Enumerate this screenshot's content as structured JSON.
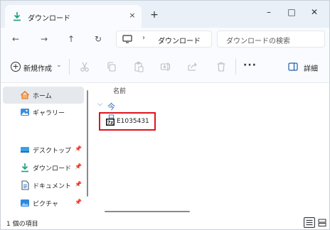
{
  "tab": {
    "title": "ダウンロード",
    "close_glyph": "×"
  },
  "titlebar": {
    "new_tab_glyph": "+",
    "minimize_glyph": "–",
    "maximize_glyph": "□",
    "close_glyph": "✕"
  },
  "nav": {
    "back_glyph": "←",
    "forward_glyph": "→",
    "up_glyph": "↑",
    "refresh_glyph": "↻"
  },
  "address": {
    "separator": "›",
    "location": "ダウンロード"
  },
  "search": {
    "placeholder": "ダウンロードの検索"
  },
  "commandbar": {
    "new_label": "新規作成",
    "new_chevron": "⌄",
    "more_glyph": "···",
    "details_label": "詳細",
    "icons": [
      "cut-icon",
      "copy-icon",
      "paste-icon",
      "rename-icon",
      "share-icon",
      "delete-icon"
    ]
  },
  "sidebar": {
    "items": [
      {
        "label": "ホーム",
        "icon": "home-icon",
        "selected": true,
        "pinned": false
      },
      {
        "label": "ギャラリー",
        "icon": "gallery-icon",
        "selected": false,
        "pinned": false
      },
      {
        "label": "デスクトップ",
        "icon": "desktop-icon",
        "selected": false,
        "pinned": true
      },
      {
        "label": "ダウンロード",
        "icon": "download-icon",
        "selected": false,
        "pinned": true
      },
      {
        "label": "ドキュメント",
        "icon": "documents-icon",
        "selected": false,
        "pinned": true
      },
      {
        "label": "ピクチャ",
        "icon": "pictures-icon",
        "selected": false,
        "pinned": true
      }
    ],
    "pin_glyph": "📌"
  },
  "main": {
    "column_header": "名前",
    "group": {
      "chevron": "⌵",
      "label": "今日"
    },
    "files": [
      {
        "name": "E1035431",
        "icon": "7z-archive-icon",
        "highlighted": true
      }
    ]
  },
  "status": {
    "item_count": "1 個の項目"
  },
  "colors": {
    "accent": "#2d6db5",
    "highlight_border": "#e0141c",
    "tab_strip": "#eaf0f7",
    "selected_item": "#e5e8ed"
  }
}
